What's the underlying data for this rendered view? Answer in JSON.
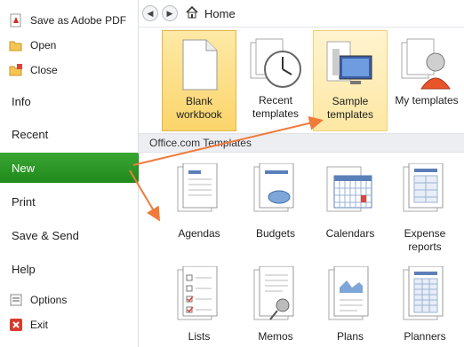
{
  "sidebar": {
    "commands": [
      {
        "label": "Save as Adobe PDF",
        "icon": "pdf-icon"
      },
      {
        "label": "Open",
        "icon": "open-folder-icon"
      },
      {
        "label": "Close",
        "icon": "close-folder-icon"
      }
    ],
    "tabs": [
      "Info",
      "Recent",
      "New",
      "Print",
      "Save & Send",
      "Help"
    ],
    "active_tab": "New",
    "bottom": [
      {
        "label": "Options",
        "icon": "options-icon"
      },
      {
        "label": "Exit",
        "icon": "exit-icon"
      }
    ]
  },
  "main": {
    "address": "Home",
    "templates": [
      {
        "label": "Blank workbook",
        "state": "selected"
      },
      {
        "label": "Recent templates",
        "state": "normal"
      },
      {
        "label": "Sample templates",
        "state": "hover"
      },
      {
        "label": "My templates",
        "state": "normal"
      }
    ],
    "section_title": "Office.com Templates",
    "categories_row1": [
      "Agendas",
      "Budgets",
      "Calendars",
      "Expense reports"
    ],
    "categories_row2": [
      "Lists",
      "Memos",
      "Plans",
      "Planners"
    ]
  },
  "colors": {
    "accent_green": "#2a9a25",
    "selection": "#fbd56b",
    "arrow": "#f07a3a"
  }
}
